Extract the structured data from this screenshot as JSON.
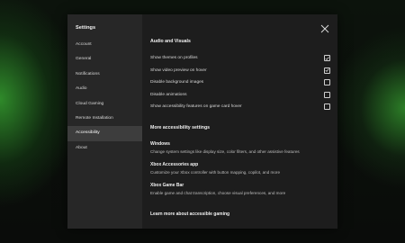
{
  "sidebar": {
    "title": "Settings",
    "items": [
      {
        "label": "Account"
      },
      {
        "label": "General"
      },
      {
        "label": "Notifications"
      },
      {
        "label": "Audio"
      },
      {
        "label": "Cloud Gaming"
      },
      {
        "label": "Remote Installation"
      },
      {
        "label": "Accessibility"
      },
      {
        "label": "About"
      }
    ],
    "active": "Accessibility"
  },
  "main": {
    "section1_title": "Audio and Visuals",
    "options": [
      {
        "label": "Show themes on profiles",
        "checked": true
      },
      {
        "label": "Show video preview on hover",
        "checked": true
      },
      {
        "label": "Disable background images",
        "checked": false
      },
      {
        "label": "Disable animations",
        "checked": false
      },
      {
        "label": "Show accessibility features on game card hover",
        "checked": false
      }
    ],
    "section2_title": "More accessibility settings",
    "links": [
      {
        "title": "Windows",
        "desc": "Change system settings like display size, color filters, and other assistive features"
      },
      {
        "title": "Xbox Accessories app",
        "desc": "Customize your Xbox controller with button mapping, copilot, and more"
      },
      {
        "title": "Xbox Game Bar",
        "desc": "Enable game and chat transcription, choose visual preferences, and more"
      }
    ],
    "learn_more": "Learn more about accessible gaming"
  },
  "icons": {
    "close": "close-icon",
    "checkmark": "checkmark-icon"
  }
}
